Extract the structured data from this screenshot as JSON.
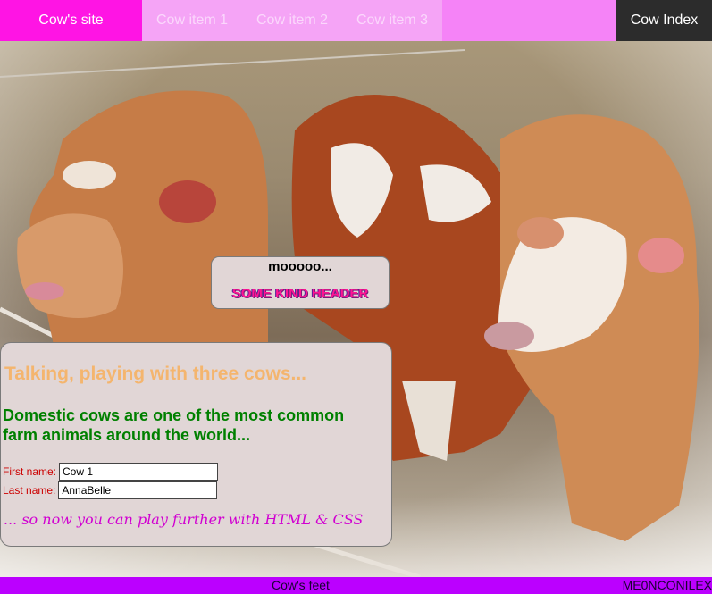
{
  "nav": {
    "brand": "Cow's site",
    "items": [
      "Cow item 1",
      "Cow item 2",
      "Cow item 3"
    ],
    "index": "Cow Index"
  },
  "moo": {
    "text": "mooooo...",
    "header": "SOME KIND HEADER"
  },
  "panel": {
    "title": "Talking, playing with three cows...",
    "subtitle": "Domestic cows are one of the most common farm animals around the world...",
    "form": {
      "first_label": "First name:",
      "first_value": "Cow 1",
      "last_label": "Last name:",
      "last_value": "AnnaBelle"
    },
    "tagline": "... so now you can play further with HTML & CSS"
  },
  "footer": {
    "text": "Cow's feet",
    "brand": "ME0NCONILEX"
  },
  "colors": {
    "nav_bg": "#f583f7",
    "brand_bg": "#ff14e4",
    "index_bg": "#2c2c2c",
    "footer_bg": "#bb00ff",
    "title": "#f4b56e",
    "subtitle": "#008000",
    "tagline": "#d100d1"
  }
}
